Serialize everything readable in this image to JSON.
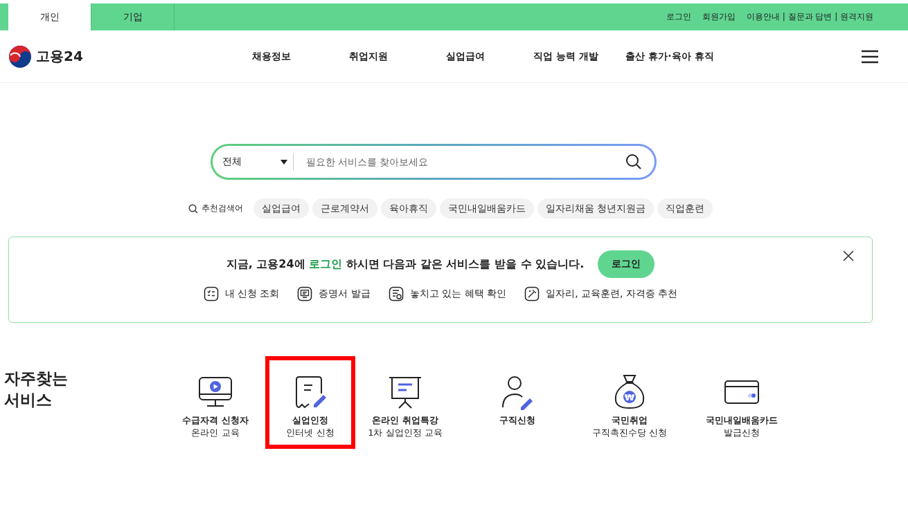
{
  "top_tabs": [
    {
      "label": "개인",
      "selected": true
    },
    {
      "label": "기업",
      "selected": false
    }
  ],
  "utility_links": [
    "로그인",
    "회원가입",
    "이용안내 | 질문과 답변 | 원격지원"
  ],
  "logo": {
    "text": "고용24"
  },
  "nav": [
    "채용정보",
    "취업지원",
    "실업급여",
    "직업 능력 개발",
    "출산 휴가·육아 휴직"
  ],
  "search": {
    "category": "전체",
    "placeholder": "필요한 서비스를 찾아보세요"
  },
  "recommended": {
    "label": "추천검색어",
    "tags": [
      "실업급여",
      "근로계약서",
      "육아휴직",
      "국민내일배움카드",
      "일자리채움 청년지원금",
      "직업훈련"
    ]
  },
  "banner": {
    "message": "지금, 고용24에 **로그인** 하시면 다음과 같은 서비스를 받을 수 있습니다.",
    "button": "로그인",
    "features": [
      {
        "kind": "list",
        "label": "내 신청 조회"
      },
      {
        "kind": "certificate",
        "label": "증명서 발급"
      },
      {
        "kind": "document",
        "label": "놓치고 있는 혜택 확인"
      },
      {
        "kind": "magic",
        "label": "일자리, 교육훈련, 자격증 추천"
      }
    ]
  },
  "frequent": {
    "title": "자주찾는 서비스",
    "services": [
      {
        "kind": "monitor",
        "line1": "수급자격 신청자",
        "line2": "온라인 교육",
        "highlighted": false
      },
      {
        "kind": "form",
        "line1": "실업인정",
        "line2": "인터넷 신청",
        "highlighted": true
      },
      {
        "kind": "board",
        "line1": "온라인 취업특강",
        "line2": "1차 실업인정 교육",
        "highlighted": false
      },
      {
        "kind": "person",
        "line1": "구직신청",
        "highlighted": false
      },
      {
        "kind": "moneybag",
        "symbol": "₩",
        "line1": "국민취업",
        "line2": "구직촉진수당 신청",
        "highlighted": false
      },
      {
        "kind": "card",
        "line1": "국민내일배움카드",
        "line2": "발급신청",
        "highlighted": false
      }
    ]
  }
}
